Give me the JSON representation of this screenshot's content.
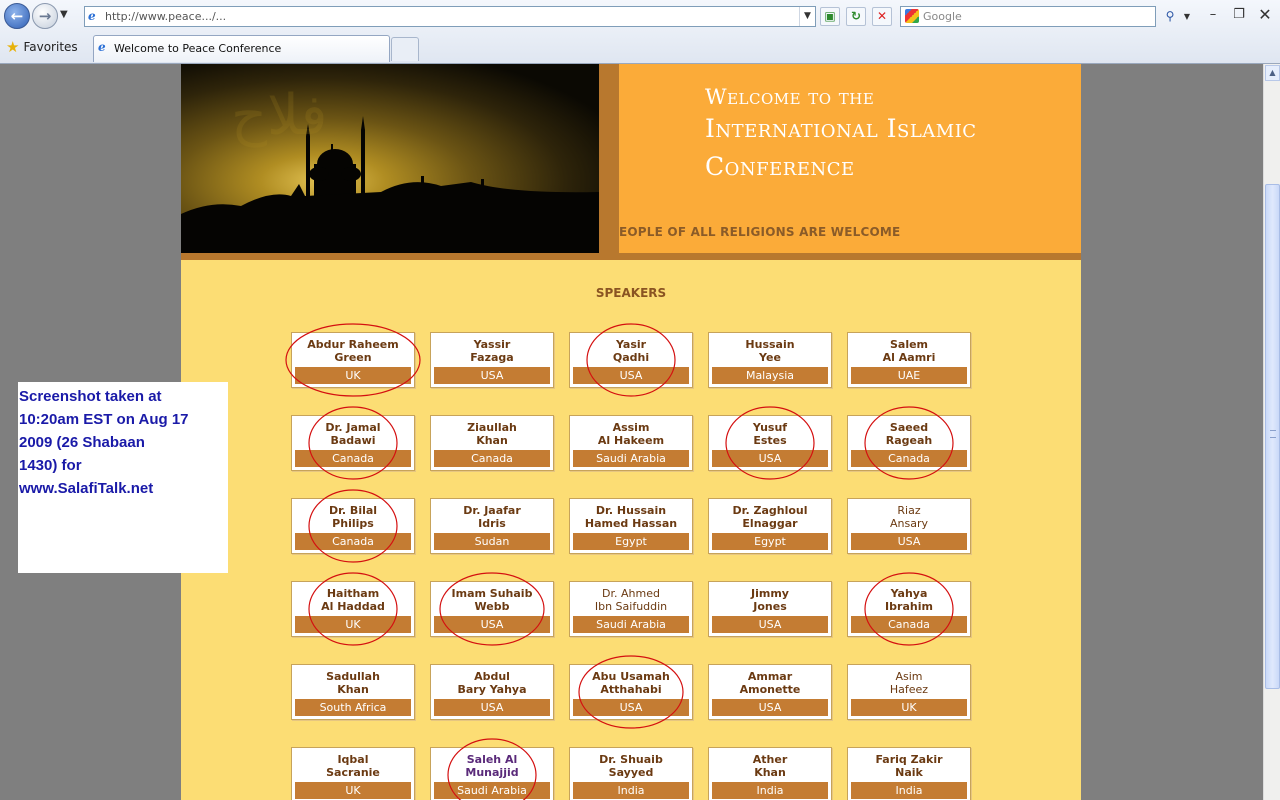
{
  "browser": {
    "address_url": "http://www.peace.../...",
    "search_placeholder": "Google",
    "favorites_label": "Favorites",
    "tab_title": "Welcome to Peace Conference"
  },
  "header": {
    "title_line1": "Welcome to the",
    "title_line2": "International Islamic",
    "title_line3": "Conference",
    "tagline": "EOPLE OF ALL RELIGIONS ARE WELCOME"
  },
  "speakers_title": "SPEAKERS",
  "speakers": [
    [
      {
        "name": "Abdur Raheem Green",
        "l1": "Abdur Raheem",
        "l2": "Green",
        "country": "UK",
        "circled": true
      },
      {
        "name": "Yassir Fazaga",
        "l1": "Yassir",
        "l2": "Fazaga",
        "country": "USA",
        "circled": false
      },
      {
        "name": "Yasir Qadhi",
        "l1": "Yasir",
        "l2": "Qadhi",
        "country": "USA",
        "circled": true
      },
      {
        "name": "Hussain Yee",
        "l1": "Hussain",
        "l2": "Yee",
        "country": "Malaysia",
        "circled": false
      },
      {
        "name": "Salem Al Aamri",
        "l1": "Salem",
        "l2": "Al Aamri",
        "country": "UAE",
        "circled": false
      }
    ],
    [
      {
        "name": "Dr. Jamal Badawi",
        "l1": "Dr. Jamal",
        "l2": "Badawi",
        "country": "Canada",
        "circled": true
      },
      {
        "name": "Ziaullah Khan",
        "l1": "Ziaullah",
        "l2": "Khan",
        "country": "Canada",
        "circled": false
      },
      {
        "name": "Assim Al Hakeem",
        "l1": "Assim",
        "l2": "Al Hakeem",
        "country": "Saudi Arabia",
        "circled": false
      },
      {
        "name": "Yusuf Estes",
        "l1": "Yusuf",
        "l2": "Estes",
        "country": "USA",
        "circled": true
      },
      {
        "name": "Saeed Rageah",
        "l1": "Saeed",
        "l2": "Rageah",
        "country": "Canada",
        "circled": true
      }
    ],
    [
      {
        "name": "Dr. Bilal Philips",
        "l1": "Dr. Bilal",
        "l2": "Philips",
        "country": "Canada",
        "circled": true
      },
      {
        "name": "Dr. Jaafar Idris",
        "l1": "Dr. Jaafar",
        "l2": "Idris",
        "country": "Sudan",
        "circled": false
      },
      {
        "name": "Dr. Hussain Hamed Hassan",
        "l1": "Dr. Hussain",
        "l2": "Hamed Hassan",
        "country": "Egypt",
        "circled": false
      },
      {
        "name": "Dr. Zaghloul Elnaggar",
        "l1": "Dr. Zaghloul",
        "l2": "Elnaggar",
        "country": "Egypt",
        "circled": false
      },
      {
        "name": "Riaz Ansary",
        "l1": "Riaz",
        "l2": "Ansary",
        "country": "USA",
        "circled": false,
        "style": "regular"
      }
    ],
    [
      {
        "name": "Haitham Al Haddad",
        "l1": "Haitham",
        "l2": "Al Haddad",
        "country": "UK",
        "circled": true
      },
      {
        "name": "Imam Suhaib Webb",
        "l1": "Imam Suhaib",
        "l2": "Webb",
        "country": "USA",
        "circled": true
      },
      {
        "name": "Dr. Ahmed Ibn Saifuddin",
        "l1": "Dr. Ahmed",
        "l2": "Ibn Saifuddin",
        "country": "Saudi Arabia",
        "circled": false,
        "style": "regular"
      },
      {
        "name": "Jimmy Jones",
        "l1": "Jimmy",
        "l2": "Jones",
        "country": "USA",
        "circled": false
      },
      {
        "name": "Yahya Ibrahim",
        "l1": "Yahya",
        "l2": "Ibrahim",
        "country": "Canada",
        "circled": true
      }
    ],
    [
      {
        "name": "Sadullah Khan",
        "l1": "Sadullah",
        "l2": "Khan",
        "country": "South Africa",
        "circled": false
      },
      {
        "name": "Abdul Bary Yahya",
        "l1": "Abdul",
        "l2": "Bary Yahya",
        "country": "USA",
        "circled": false
      },
      {
        "name": "Abu Usamah Atthahabi",
        "l1": "Abu Usamah",
        "l2": "Atthahabi",
        "country": "USA",
        "circled": true
      },
      {
        "name": "Ammar Amonette",
        "l1": "Ammar",
        "l2": "Amonette",
        "country": "USA",
        "circled": false
      },
      {
        "name": "Asim Hafeez",
        "l1": "Asim",
        "l2": "Hafeez",
        "country": "UK",
        "circled": false,
        "style": "regular"
      }
    ],
    [
      {
        "name": "Iqbal Sacranie",
        "l1": "Iqbal",
        "l2": "Sacranie",
        "country": "UK",
        "circled": false
      },
      {
        "name": "Saleh Al Munajjid",
        "l1": "Saleh Al",
        "l2": "Munajjid",
        "country": "Saudi Arabia",
        "circled": true,
        "style": "purple"
      },
      {
        "name": "Dr. Shuaib Sayyed",
        "l1": "Dr. Shuaib",
        "l2": "Sayyed",
        "country": "India",
        "circled": false
      },
      {
        "name": "Ather Khan",
        "l1": "Ather",
        "l2": "Khan",
        "country": "India",
        "circled": false
      },
      {
        "name": "Fariq Zakir Naik",
        "l1": "Fariq Zakir",
        "l2": "Naik",
        "country": "India",
        "circled": false
      }
    ]
  ],
  "note": {
    "line1": "Screenshot taken at",
    "line2": "10:20am EST on Aug 17",
    "line3": "2009 (26 Shabaan",
    "line4": "1430) for",
    "line5": "www.SalafiTalk.net"
  },
  "colors": {
    "page_bg": "#fcdd74",
    "header_orange": "#fbab39",
    "country_bar": "#c47c33",
    "annotation_red": "#d41010",
    "note_text": "#1a1aa8"
  },
  "icons": {
    "back": "back-arrow-icon",
    "forward": "forward-arrow-icon",
    "refresh": "refresh-icon",
    "stop": "stop-icon",
    "search": "search-icon",
    "favorites": "star-icon"
  }
}
